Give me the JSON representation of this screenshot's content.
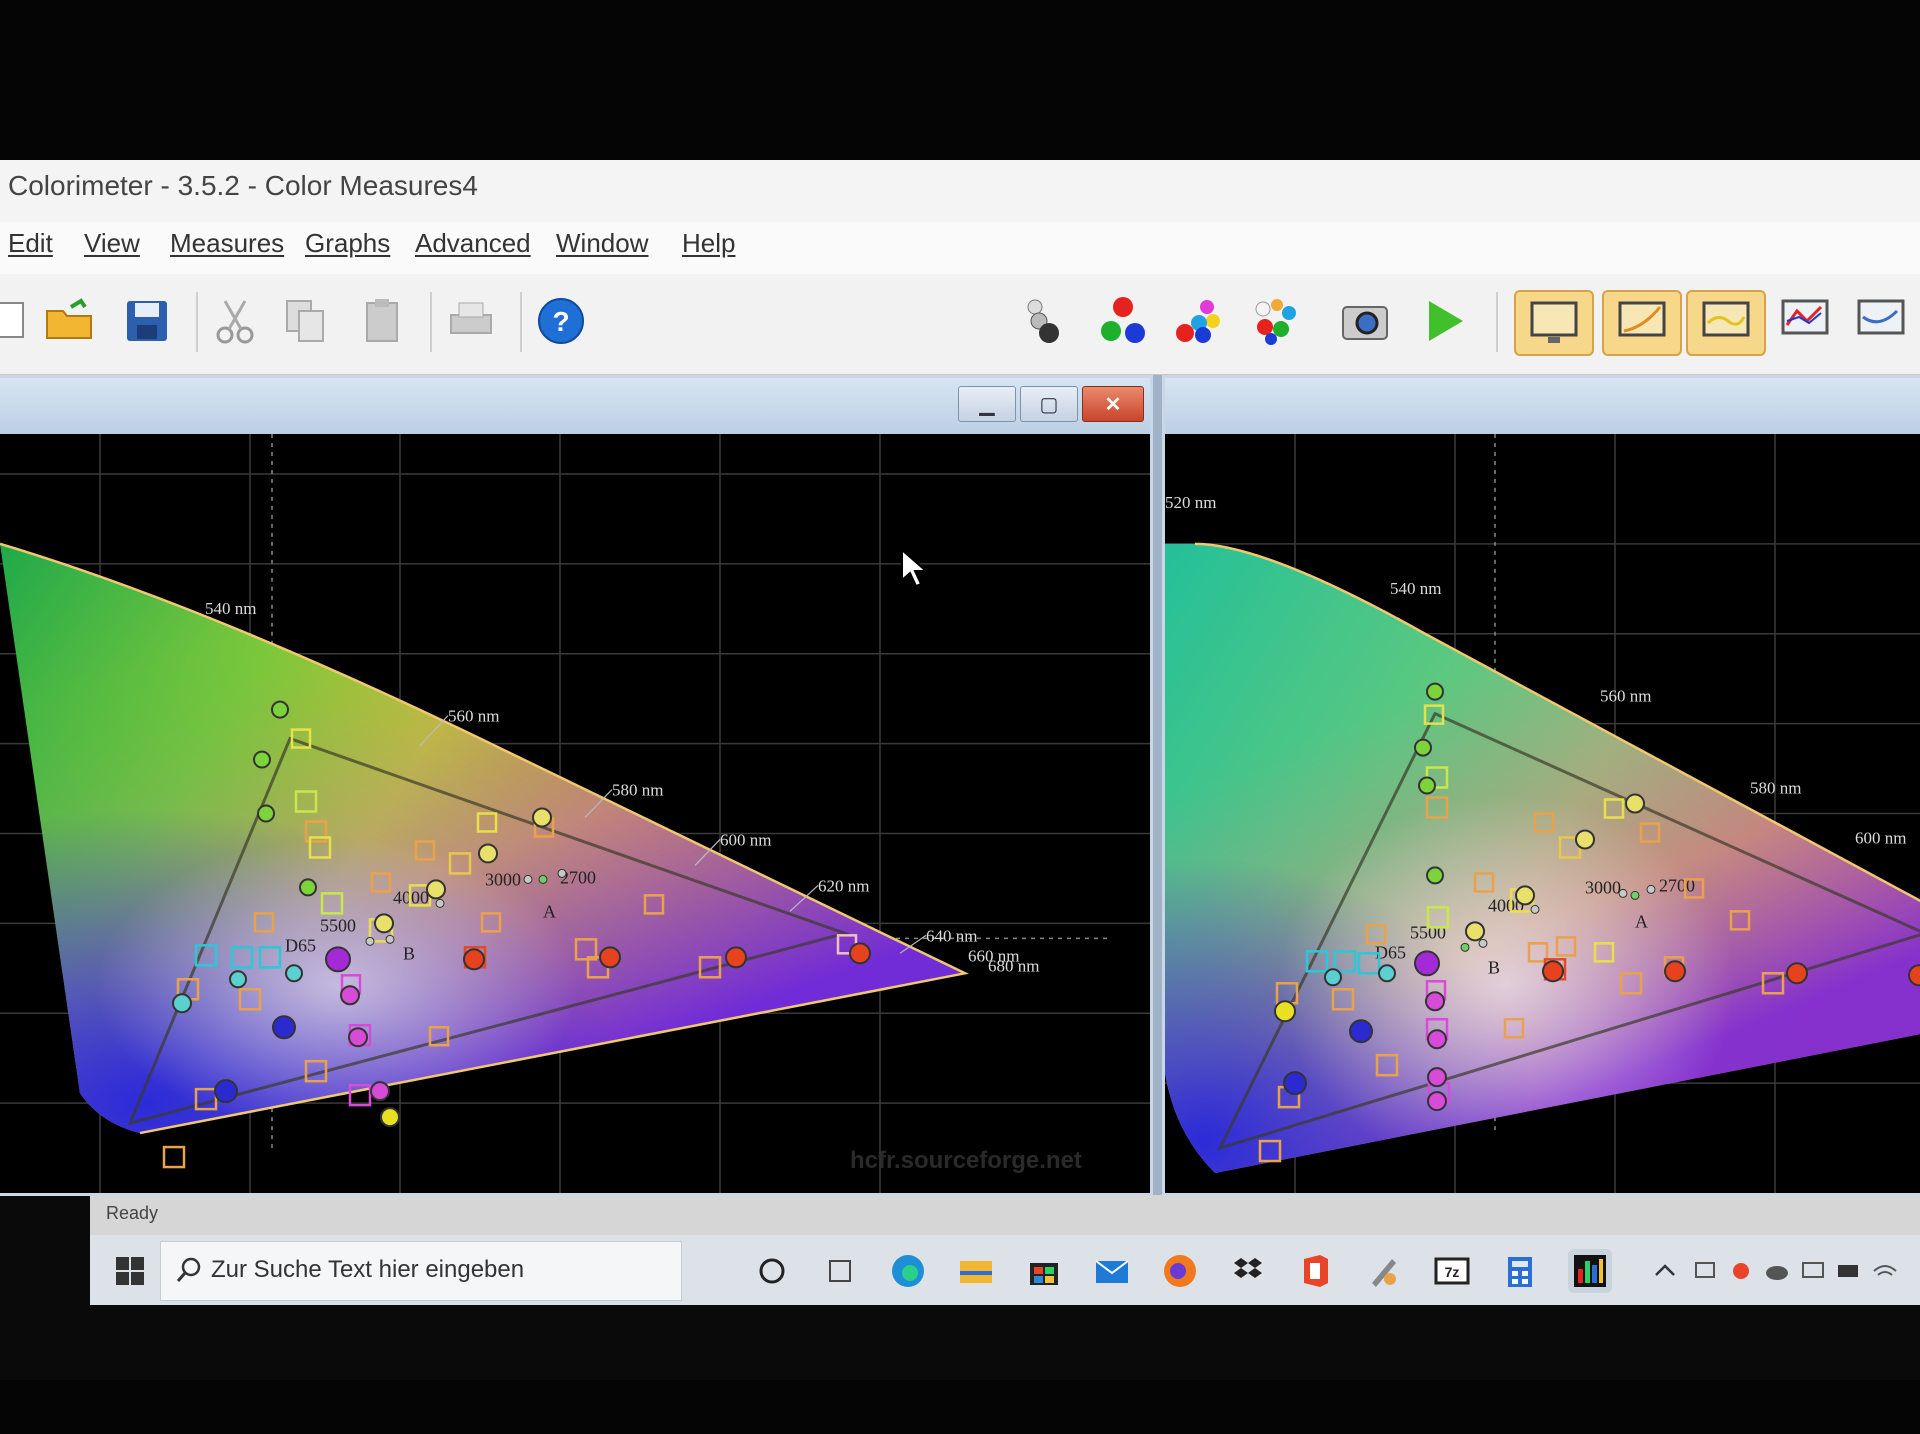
{
  "app": {
    "title": "Colorimeter - 3.5.2 - Color Measures4"
  },
  "menu": [
    "Edit",
    "View",
    "Measures",
    "Graphs",
    "Advanced",
    "Window",
    "Help"
  ],
  "toolbar": {
    "left_icons": [
      "new-icon",
      "open-folder-icon",
      "save-icon",
      "cut-icon",
      "copy-icon",
      "paste-icon",
      "print-icon",
      "help-icon"
    ],
    "right_icons": [
      "sensor-icon",
      "rgb-primaries-icon",
      "color-balls-icon",
      "saturation-balls-icon",
      "camera-icon",
      "play-icon",
      "view-display-icon",
      "view-gamma-icon",
      "view-luminance-icon",
      "view-rgb-levels-icon",
      "view-gamma-curve-icon"
    ]
  },
  "left_window": {
    "wavelength_labels": [
      "540 nm",
      "560 nm",
      "580 nm",
      "600 nm",
      "620 nm",
      "640 nm",
      "660 nm",
      "680 nm"
    ],
    "temperature_labels": [
      "3000",
      "2700",
      "4000",
      "5500",
      "A",
      "B",
      "D65"
    ],
    "watermark": "hcfr.sourceforge.net"
  },
  "right_window": {
    "wavelength_labels": [
      "520 nm",
      "540 nm",
      "560 nm",
      "580 nm",
      "600 nm"
    ],
    "temperature_labels": [
      "3000",
      "2700",
      "4000",
      "5500",
      "A",
      "B",
      "D65"
    ]
  },
  "status": {
    "text": "Ready"
  },
  "taskbar": {
    "search_placeholder": "Zur Suche Text hier eingeben",
    "apps": [
      "cortana-icon",
      "task-view-icon",
      "edge-icon",
      "file-explorer-icon",
      "store-icon",
      "mail-icon",
      "firefox-icon",
      "dropbox-icon",
      "office-icon",
      "paint-icon",
      "7zip-icon",
      "calculator-icon",
      "colorimeter-icon"
    ]
  }
}
